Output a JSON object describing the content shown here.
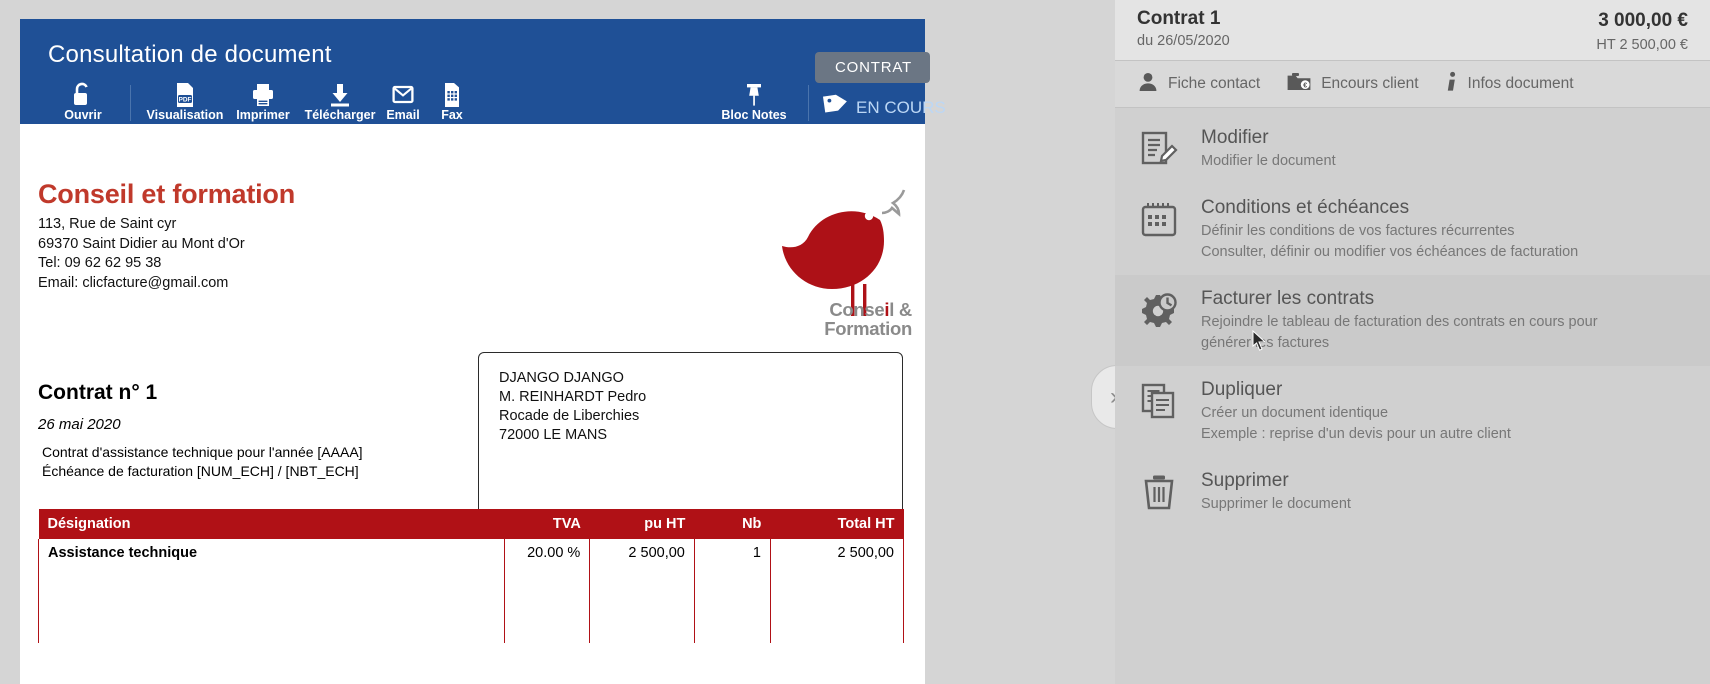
{
  "viewer": {
    "title": "Consultation de document",
    "doc_type_badge": "CONTRAT",
    "status_tag": "EN COURS",
    "toolbar": [
      {
        "label": "Ouvrir",
        "icon": "unlock-icon"
      },
      {
        "label": "Visualisation",
        "icon": "pdf-icon"
      },
      {
        "label": "Imprimer",
        "icon": "printer-icon"
      },
      {
        "label": "Télécharger",
        "icon": "download-icon"
      },
      {
        "label": "Email",
        "icon": "envelope-icon"
      },
      {
        "label": "Fax",
        "icon": "fax-icon"
      },
      {
        "label": "Bloc Notes",
        "icon": "pin-icon"
      }
    ]
  },
  "document": {
    "company_name": "Conseil et formation",
    "company_address_1": "113, Rue de Saint cyr",
    "company_address_2": "69370 Saint Didier au Mont d'Or",
    "company_phone": "Tel: 09 62 62 95 38",
    "company_email": "Email: clicfacture@gmail.com",
    "logo_caption_line1_a": "Conse",
    "logo_caption_line1_i": "i",
    "logo_caption_line1_b": "l &",
    "logo_caption_line2": "Formation",
    "contract_title": "Contrat n° 1",
    "contract_date": "26 mai 2020",
    "desc_line1": "Contrat d'assistance technique pour l'année [AAAA]",
    "desc_line2": "Échéance de facturation [NUM_ECH] / [NBT_ECH]",
    "client": {
      "line1": "DJANGO DJANGO",
      "line2": "M. REINHARDT Pedro",
      "line3": "Rocade de Liberchies",
      "line4": "72000 LE MANS"
    },
    "table": {
      "headers": [
        "Désignation",
        "TVA",
        "pu HT",
        "Nb",
        "Total HT"
      ],
      "rows": [
        {
          "designation": "Assistance technique",
          "tva": "20.00 %",
          "pu_ht": "2 500,00",
          "nb": "1",
          "total_ht": "2 500,00"
        }
      ]
    }
  },
  "panel": {
    "title": "Contrat 1",
    "subtitle": "du 26/05/2020",
    "amount_ttc": "3 000,00 €",
    "amount_ht": "HT  2 500,00 €",
    "tabs": [
      {
        "label": "Fiche contact",
        "icon": "person-icon"
      },
      {
        "label": "Encours client",
        "icon": "folder-euro-icon"
      },
      {
        "label": "Infos document",
        "icon": "info-icon"
      }
    ],
    "actions": [
      {
        "title": "Modifier",
        "desc1": "Modifier le document",
        "desc2": "",
        "icon": "edit-document-icon",
        "highlighted": false
      },
      {
        "title": "Conditions et échéances",
        "desc1": "Définir les conditions de vos factures récurrentes",
        "desc2": "Consulter, définir ou modifier vos échéances de facturation",
        "icon": "calendar-icon",
        "highlighted": false
      },
      {
        "title": "Facturer les contrats",
        "desc1": "Rejoindre le tableau de facturation des contrats en cours pour",
        "desc2": "générer les factures",
        "icon": "gear-clock-icon",
        "highlighted": true
      },
      {
        "title": "Dupliquer",
        "desc1": "Créer un document identique",
        "desc2": "Exemple : reprise d'un devis pour un autre client",
        "icon": "copy-icon",
        "highlighted": false
      },
      {
        "title": "Supprimer",
        "desc1": "Supprimer le document",
        "desc2": "",
        "icon": "trash-icon",
        "highlighted": false
      }
    ],
    "collapse_label": "›"
  },
  "colors": {
    "header_blue": "#1f5096",
    "brand_red": "#b01116",
    "badge_gray": "#6b7684",
    "panel_bg": "#d0d0d0"
  }
}
